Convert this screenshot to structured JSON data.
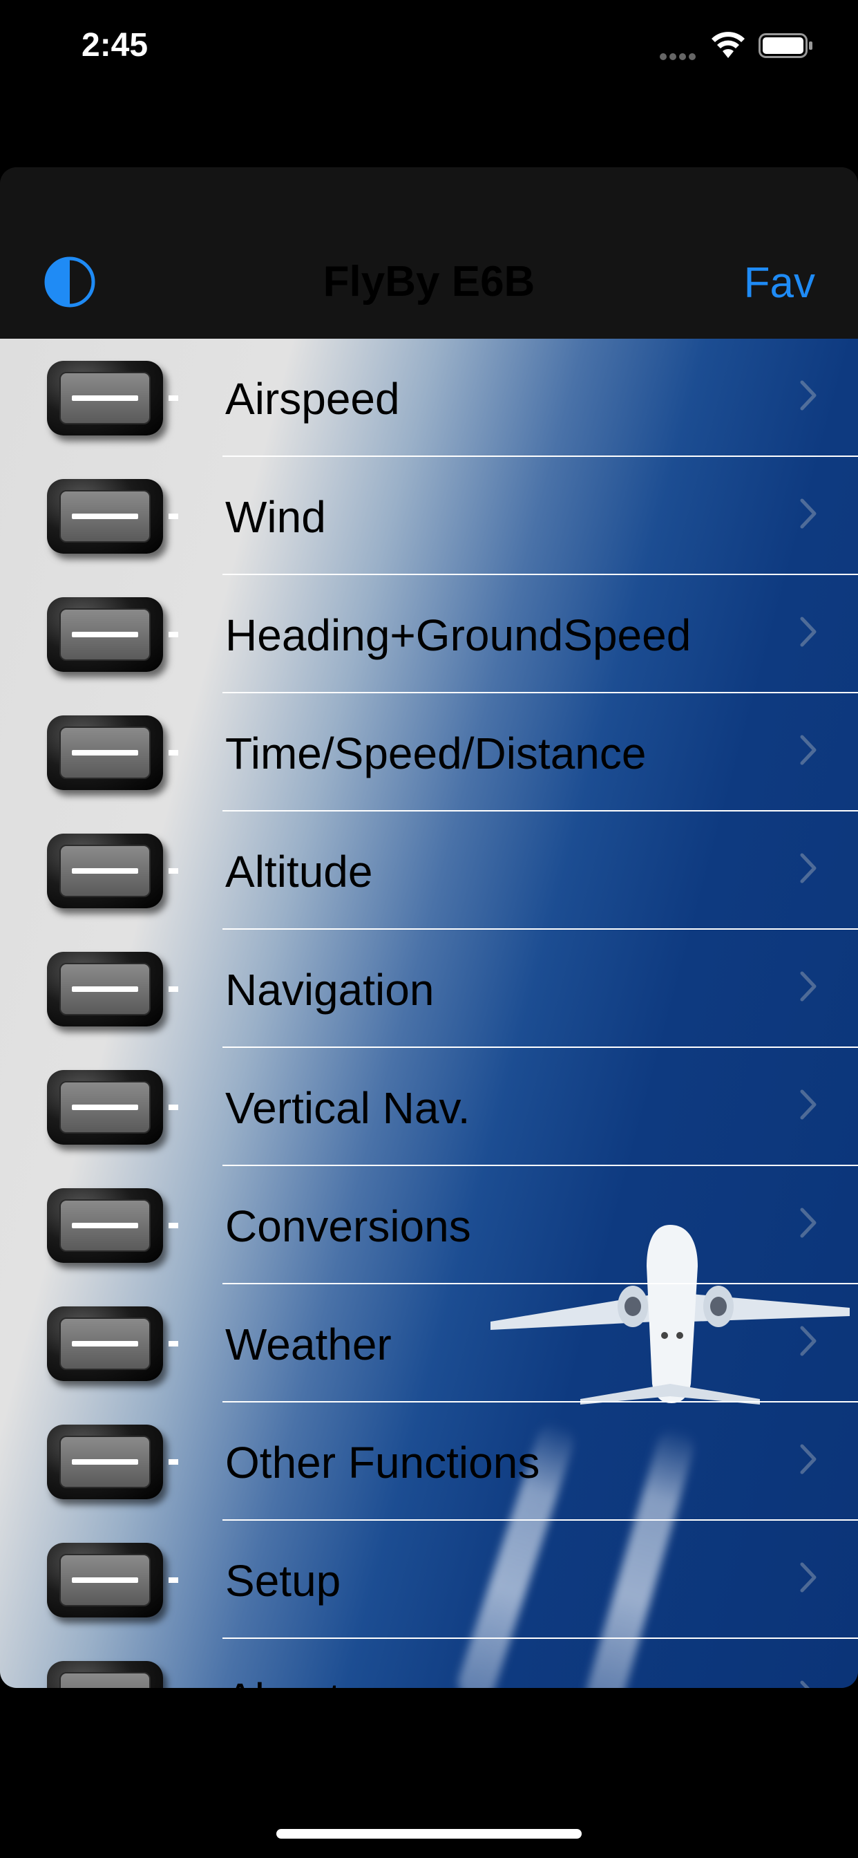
{
  "status_bar": {
    "time": "2:45"
  },
  "navbar": {
    "title": "FlyBy E6B",
    "right_label": "Fav"
  },
  "menu": [
    {
      "label": "Airspeed"
    },
    {
      "label": "Wind"
    },
    {
      "label": "Heading+GroundSpeed"
    },
    {
      "label": "Time/Speed/Distance"
    },
    {
      "label": "Altitude"
    },
    {
      "label": "Navigation"
    },
    {
      "label": "Vertical Nav."
    },
    {
      "label": "Conversions"
    },
    {
      "label": "Weather"
    },
    {
      "label": "Other Functions"
    },
    {
      "label": "Setup"
    },
    {
      "label": "About"
    }
  ],
  "colors": {
    "accent": "#1f8bf5",
    "background": "#000000",
    "navbar": "#141414"
  }
}
